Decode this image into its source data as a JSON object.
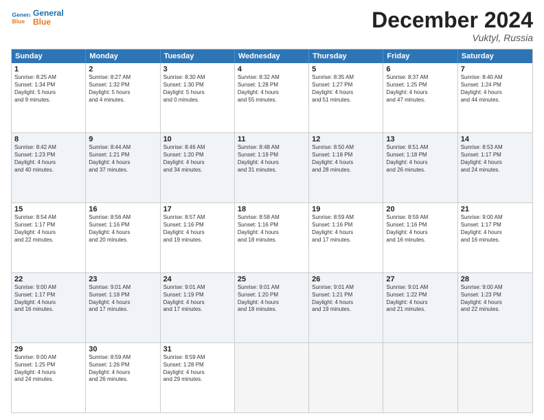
{
  "header": {
    "logo_line1": "General",
    "logo_line2": "Blue",
    "month_title": "December 2024",
    "location": "Vuktyl, Russia"
  },
  "weekdays": [
    "Sunday",
    "Monday",
    "Tuesday",
    "Wednesday",
    "Thursday",
    "Friday",
    "Saturday"
  ],
  "rows": [
    [
      {
        "day": "1",
        "lines": [
          "Sunrise: 8:25 AM",
          "Sunset: 1:34 PM",
          "Daylight: 5 hours",
          "and 9 minutes."
        ]
      },
      {
        "day": "2",
        "lines": [
          "Sunrise: 8:27 AM",
          "Sunset: 1:32 PM",
          "Daylight: 5 hours",
          "and 4 minutes."
        ]
      },
      {
        "day": "3",
        "lines": [
          "Sunrise: 8:30 AM",
          "Sunset: 1:30 PM",
          "Daylight: 5 hours",
          "and 0 minutes."
        ]
      },
      {
        "day": "4",
        "lines": [
          "Sunrise: 8:32 AM",
          "Sunset: 1:28 PM",
          "Daylight: 4 hours",
          "and 55 minutes."
        ]
      },
      {
        "day": "5",
        "lines": [
          "Sunrise: 8:35 AM",
          "Sunset: 1:27 PM",
          "Daylight: 4 hours",
          "and 51 minutes."
        ]
      },
      {
        "day": "6",
        "lines": [
          "Sunrise: 8:37 AM",
          "Sunset: 1:25 PM",
          "Daylight: 4 hours",
          "and 47 minutes."
        ]
      },
      {
        "day": "7",
        "lines": [
          "Sunrise: 8:40 AM",
          "Sunset: 1:24 PM",
          "Daylight: 4 hours",
          "and 44 minutes."
        ]
      }
    ],
    [
      {
        "day": "8",
        "lines": [
          "Sunrise: 8:42 AM",
          "Sunset: 1:23 PM",
          "Daylight: 4 hours",
          "and 40 minutes."
        ]
      },
      {
        "day": "9",
        "lines": [
          "Sunrise: 8:44 AM",
          "Sunset: 1:21 PM",
          "Daylight: 4 hours",
          "and 37 minutes."
        ]
      },
      {
        "day": "10",
        "lines": [
          "Sunrise: 8:46 AM",
          "Sunset: 1:20 PM",
          "Daylight: 4 hours",
          "and 34 minutes."
        ]
      },
      {
        "day": "11",
        "lines": [
          "Sunrise: 8:48 AM",
          "Sunset: 1:19 PM",
          "Daylight: 4 hours",
          "and 31 minutes."
        ]
      },
      {
        "day": "12",
        "lines": [
          "Sunrise: 8:50 AM",
          "Sunset: 1:18 PM",
          "Daylight: 4 hours",
          "and 28 minutes."
        ]
      },
      {
        "day": "13",
        "lines": [
          "Sunrise: 8:51 AM",
          "Sunset: 1:18 PM",
          "Daylight: 4 hours",
          "and 26 minutes."
        ]
      },
      {
        "day": "14",
        "lines": [
          "Sunrise: 8:53 AM",
          "Sunset: 1:17 PM",
          "Daylight: 4 hours",
          "and 24 minutes."
        ]
      }
    ],
    [
      {
        "day": "15",
        "lines": [
          "Sunrise: 8:54 AM",
          "Sunset: 1:17 PM",
          "Daylight: 4 hours",
          "and 22 minutes."
        ]
      },
      {
        "day": "16",
        "lines": [
          "Sunrise: 8:56 AM",
          "Sunset: 1:16 PM",
          "Daylight: 4 hours",
          "and 20 minutes."
        ]
      },
      {
        "day": "17",
        "lines": [
          "Sunrise: 8:57 AM",
          "Sunset: 1:16 PM",
          "Daylight: 4 hours",
          "and 19 minutes."
        ]
      },
      {
        "day": "18",
        "lines": [
          "Sunrise: 8:58 AM",
          "Sunset: 1:16 PM",
          "Daylight: 4 hours",
          "and 18 minutes."
        ]
      },
      {
        "day": "19",
        "lines": [
          "Sunrise: 8:59 AM",
          "Sunset: 1:16 PM",
          "Daylight: 4 hours",
          "and 17 minutes."
        ]
      },
      {
        "day": "20",
        "lines": [
          "Sunrise: 8:59 AM",
          "Sunset: 1:16 PM",
          "Daylight: 4 hours",
          "and 16 minutes."
        ]
      },
      {
        "day": "21",
        "lines": [
          "Sunrise: 9:00 AM",
          "Sunset: 1:17 PM",
          "Daylight: 4 hours",
          "and 16 minutes."
        ]
      }
    ],
    [
      {
        "day": "22",
        "lines": [
          "Sunrise: 9:00 AM",
          "Sunset: 1:17 PM",
          "Daylight: 4 hours",
          "and 16 minutes."
        ]
      },
      {
        "day": "23",
        "lines": [
          "Sunrise: 9:01 AM",
          "Sunset: 1:18 PM",
          "Daylight: 4 hours",
          "and 17 minutes."
        ]
      },
      {
        "day": "24",
        "lines": [
          "Sunrise: 9:01 AM",
          "Sunset: 1:19 PM",
          "Daylight: 4 hours",
          "and 17 minutes."
        ]
      },
      {
        "day": "25",
        "lines": [
          "Sunrise: 9:01 AM",
          "Sunset: 1:20 PM",
          "Daylight: 4 hours",
          "and 18 minutes."
        ]
      },
      {
        "day": "26",
        "lines": [
          "Sunrise: 9:01 AM",
          "Sunset: 1:21 PM",
          "Daylight: 4 hours",
          "and 19 minutes."
        ]
      },
      {
        "day": "27",
        "lines": [
          "Sunrise: 9:01 AM",
          "Sunset: 1:22 PM",
          "Daylight: 4 hours",
          "and 21 minutes."
        ]
      },
      {
        "day": "28",
        "lines": [
          "Sunrise: 9:00 AM",
          "Sunset: 1:23 PM",
          "Daylight: 4 hours",
          "and 22 minutes."
        ]
      }
    ],
    [
      {
        "day": "29",
        "lines": [
          "Sunrise: 9:00 AM",
          "Sunset: 1:25 PM",
          "Daylight: 4 hours",
          "and 24 minutes."
        ]
      },
      {
        "day": "30",
        "lines": [
          "Sunrise: 8:59 AM",
          "Sunset: 1:26 PM",
          "Daylight: 4 hours",
          "and 26 minutes."
        ]
      },
      {
        "day": "31",
        "lines": [
          "Sunrise: 8:59 AM",
          "Sunset: 1:28 PM",
          "Daylight: 4 hours",
          "and 29 minutes."
        ]
      },
      {
        "day": "",
        "lines": []
      },
      {
        "day": "",
        "lines": []
      },
      {
        "day": "",
        "lines": []
      },
      {
        "day": "",
        "lines": []
      }
    ]
  ]
}
